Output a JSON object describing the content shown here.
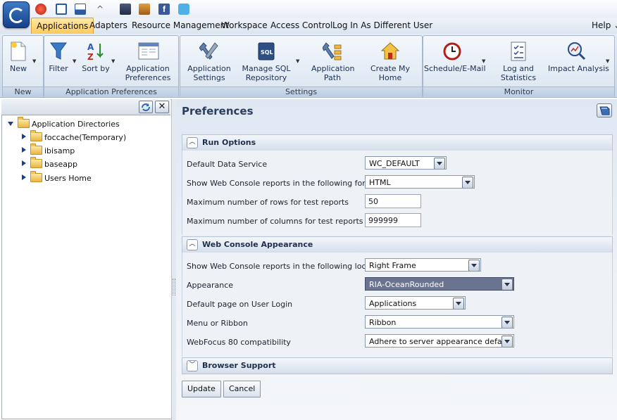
{
  "menu": {
    "items": [
      "Applications",
      "Adapters",
      "Resource Management",
      "Workspace",
      "Access Control",
      "Log In As Different User"
    ],
    "help": "Help"
  },
  "ribbon": {
    "groups": {
      "new": "New",
      "app_prefs": "Application Preferences",
      "settings": "Settings",
      "monitor": "Monitor"
    },
    "buttons": {
      "new": "New",
      "filter": "Filter",
      "sort_by": "Sort by",
      "app_prefs_1": "Application",
      "app_prefs_2": "Preferences",
      "app_settings_1": "Application",
      "app_settings_2": "Settings",
      "manage_sql_1": "Manage SQL",
      "manage_sql_2": "Repository",
      "app_path_1": "Application",
      "app_path_2": "Path",
      "create_home_1": "Create My",
      "create_home_2": "Home",
      "schedule": "Schedule/E-Mail",
      "log_stats_1": "Log and",
      "log_stats_2": "Statistics",
      "impact": "Impact Analysis"
    }
  },
  "tree": {
    "root": "Application Directories",
    "children": [
      "foccache(Temporary)",
      "ibisamp",
      "baseapp",
      "Users Home"
    ]
  },
  "preferences": {
    "title": "Preferences",
    "run_options": {
      "title": "Run Options",
      "fields": [
        {
          "label": "Default Data Service",
          "value": "WC_DEFAULT"
        },
        {
          "label": "Show Web Console reports in the following format",
          "value": "HTML"
        },
        {
          "label": "Maximum number of rows for test reports",
          "value": "50"
        },
        {
          "label": "Maximum number of columns for test reports",
          "value": "999999"
        }
      ]
    },
    "appearance": {
      "title": "Web Console Appearance",
      "fields": [
        {
          "label": "Show Web Console reports in the following location",
          "value": "Right Frame"
        },
        {
          "label": "Appearance",
          "value": "RIA-OceanRounded"
        },
        {
          "label": "Default page on User Login",
          "value": "Applications"
        },
        {
          "label": "Menu or Ribbon",
          "value": "Ribbon"
        },
        {
          "label": "WebFocus 80 compatibility",
          "value": "Adhere to server appearance default"
        }
      ]
    },
    "browser_support": {
      "title": "Browser Support"
    },
    "buttons": {
      "update": "Update",
      "cancel": "Cancel"
    }
  },
  "colors": {
    "accent": "#ffc95a",
    "selected_field": "#6a7491",
    "title": "#2a3d5c"
  }
}
